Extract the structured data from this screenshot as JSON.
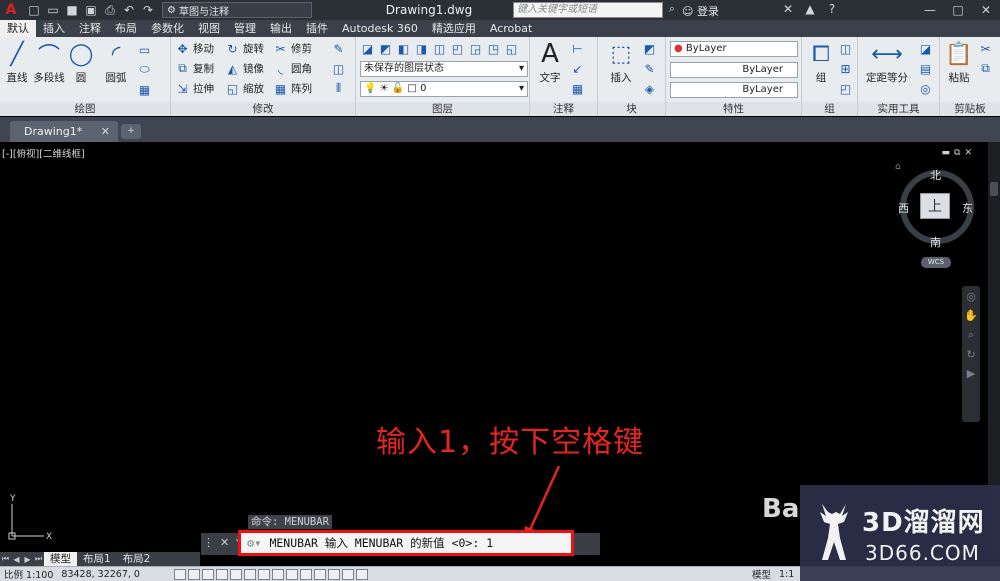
{
  "titlebar": {
    "workspace": "草图与注释",
    "document_title": "Drawing1.dwg",
    "search_placeholder": "键入关键字或短语",
    "login": "登录"
  },
  "ribbon_tabs": [
    "默认",
    "插入",
    "注释",
    "布局",
    "参数化",
    "视图",
    "管理",
    "输出",
    "插件",
    "Autodesk 360",
    "精选应用",
    "Acrobat"
  ],
  "ribbon": {
    "draw": {
      "label": "绘图",
      "tools": [
        "直线",
        "多段线",
        "圆",
        "圆弧"
      ]
    },
    "modify": {
      "label": "修改",
      "tools": [
        "移动",
        "旋转",
        "修剪",
        "复制",
        "镜像",
        "圆角",
        "拉伸",
        "缩放",
        "阵列"
      ]
    },
    "layer": {
      "label": "图层",
      "layer_state": "未保存的图层状态",
      "layer_value": "0"
    },
    "annotation": {
      "label": "注释",
      "tool": "文字"
    },
    "block": {
      "label": "块",
      "tool": "插入"
    },
    "properties": {
      "label": "特性",
      "values": [
        "ByLayer",
        "ByLayer",
        "ByLayer"
      ]
    },
    "group": {
      "label": "组",
      "tool": "组"
    },
    "utilities": {
      "label": "实用工具",
      "tool": "定距等分"
    },
    "clipboard": {
      "label": "剪贴板",
      "tool": "粘贴"
    }
  },
  "doc_tab": {
    "label": "Drawing1*"
  },
  "viewport": {
    "label": "[-][俯视][二维线框]"
  },
  "viewcube": {
    "north": "北",
    "south": "南",
    "east": "东",
    "west": "西",
    "face": "上",
    "wcs": "WCS"
  },
  "annotation_text": "输入1，按下空格键",
  "command": {
    "history": "命令: MENUBAR",
    "input": "MENUBAR 输入 MENUBAR 的新值 <0>: 1"
  },
  "layout_tabs": [
    "模型",
    "布局1",
    "布局2"
  ],
  "statusbar": {
    "scale": "比例 1:100",
    "coords": "83428, 32267, 0",
    "model": "模型",
    "anno_scale": "1:1"
  },
  "watermark": {
    "line1": "3D溜溜网",
    "line2": "3D66.COM",
    "baidu": "Ba"
  }
}
